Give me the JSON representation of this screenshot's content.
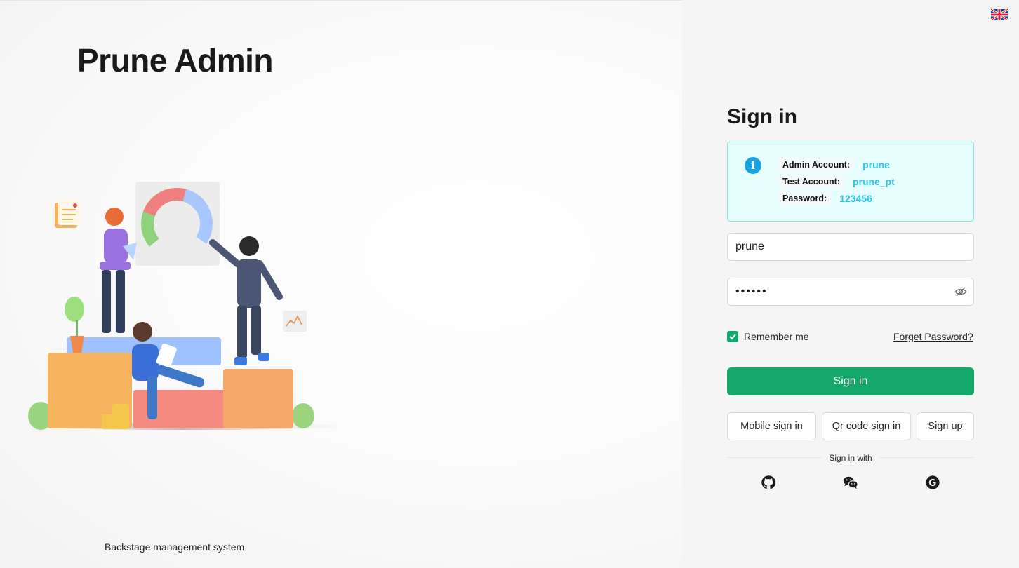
{
  "brand": {
    "title": "Prune Admin",
    "footer": "Backstage management system"
  },
  "signin": {
    "title": "Sign in",
    "info": [
      {
        "label": "Admin Account:",
        "value": "prune"
      },
      {
        "label": "Test Account:",
        "value": "prune_pt"
      },
      {
        "label": "Password:",
        "value": "123456"
      }
    ],
    "username_value": "prune",
    "password_mask": "••••••",
    "remember_label": "Remember me",
    "forget_label": "Forget Password?",
    "submit_label": "Sign in",
    "alt_buttons": [
      "Mobile sign in",
      "Qr code sign in",
      "Sign up"
    ],
    "sign_in_with": "Sign in with",
    "social": [
      "github-icon",
      "wechat-icon",
      "google-icon"
    ]
  },
  "colors": {
    "accent": "#14a86b",
    "info_border": "#87e8de",
    "info_bg": "#e6fffe",
    "info_value": "#2ec4e6"
  }
}
